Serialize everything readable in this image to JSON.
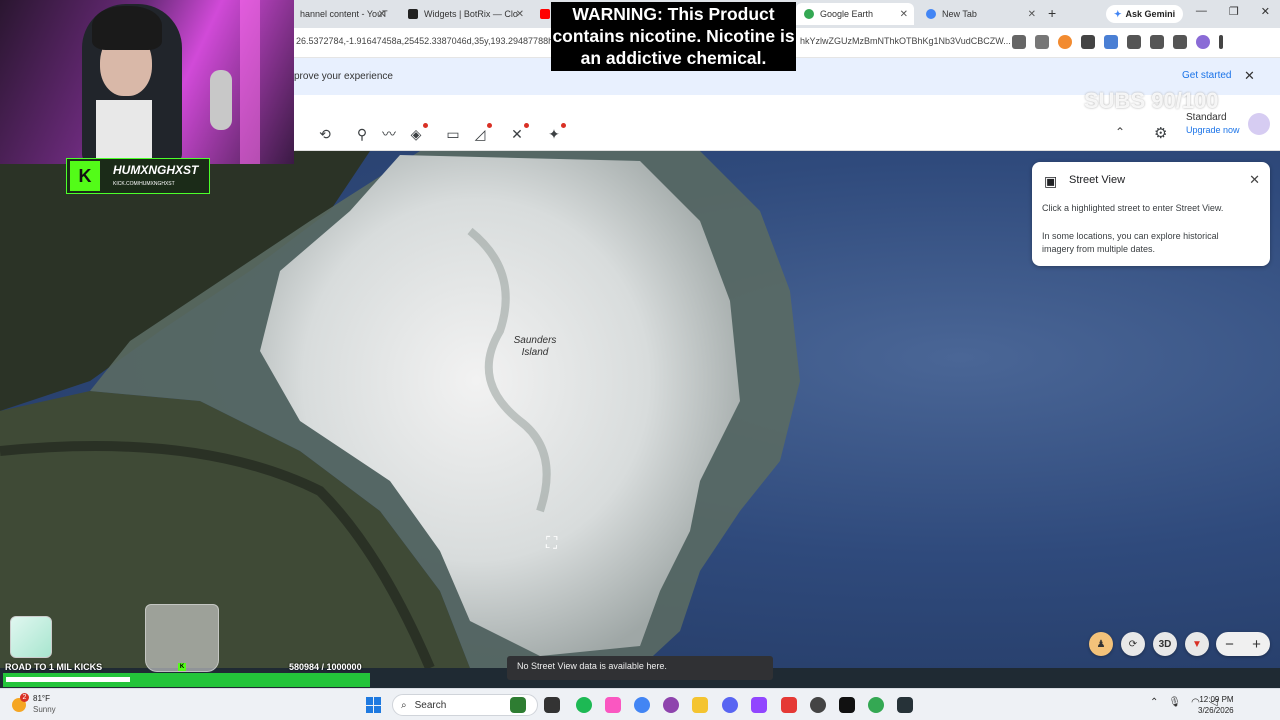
{
  "browser": {
    "tabs": [
      {
        "label": "hannel content - YouT",
        "favicon_color": "#ff0000",
        "active": false
      },
      {
        "label": "Widgets | BotRix — Clo",
        "favicon_color": "#222222",
        "active": false
      },
      {
        "label": "Google Earth",
        "favicon_color": "#34a853",
        "active": true
      },
      {
        "label": "New Tab",
        "favicon_color": "#4285f4",
        "active": false
      }
    ],
    "new_tab": "+",
    "gemini_label": "Ask Gemini",
    "window_controls": [
      "—",
      "❐",
      "✕"
    ],
    "url_left": "26.5372784,-1.91647458a,25452.3387046d,35y,193.29487788h,",
    "url_right": "hkYzlwZGUzMzBmNThkOTBhKg1Nb3VudCBCZW...",
    "infobar_message": "prove your experience",
    "infobar_cta": "Get started"
  },
  "earth": {
    "plan_name": "Standard",
    "plan_upgrade": "Upgrade now",
    "place_label": "Saunders Island",
    "street_view": {
      "title": "Street View",
      "line1": "Click a highlighted street to enter Street View.",
      "line2": "In some locations, you can explore historical imagery from multiple dates."
    },
    "controls": {
      "three_d": "3D",
      "zoom_out": "−",
      "zoom_in": "+"
    },
    "toast": "No Street View data is available here."
  },
  "overlays": {
    "warning_text": "WARNING: This Product contains nicotine. Nicotine is an addictive chemical.",
    "subs_counter": "SUBS 90/100",
    "brand_name": "HUMXNGHXST",
    "brand_sub": "KICK.COM/HUMXNGHXST",
    "goal_label": "ROAD TO 1 MIL KICKS",
    "goal_count": "580984 / 1000000",
    "goal_progress": 0.580984
  },
  "taskbar": {
    "temperature": "81°F",
    "condition": "Sunny",
    "weather_badge": "2",
    "search_placeholder": "Search",
    "time": "12:09 PM",
    "date": "3/26/2026"
  }
}
